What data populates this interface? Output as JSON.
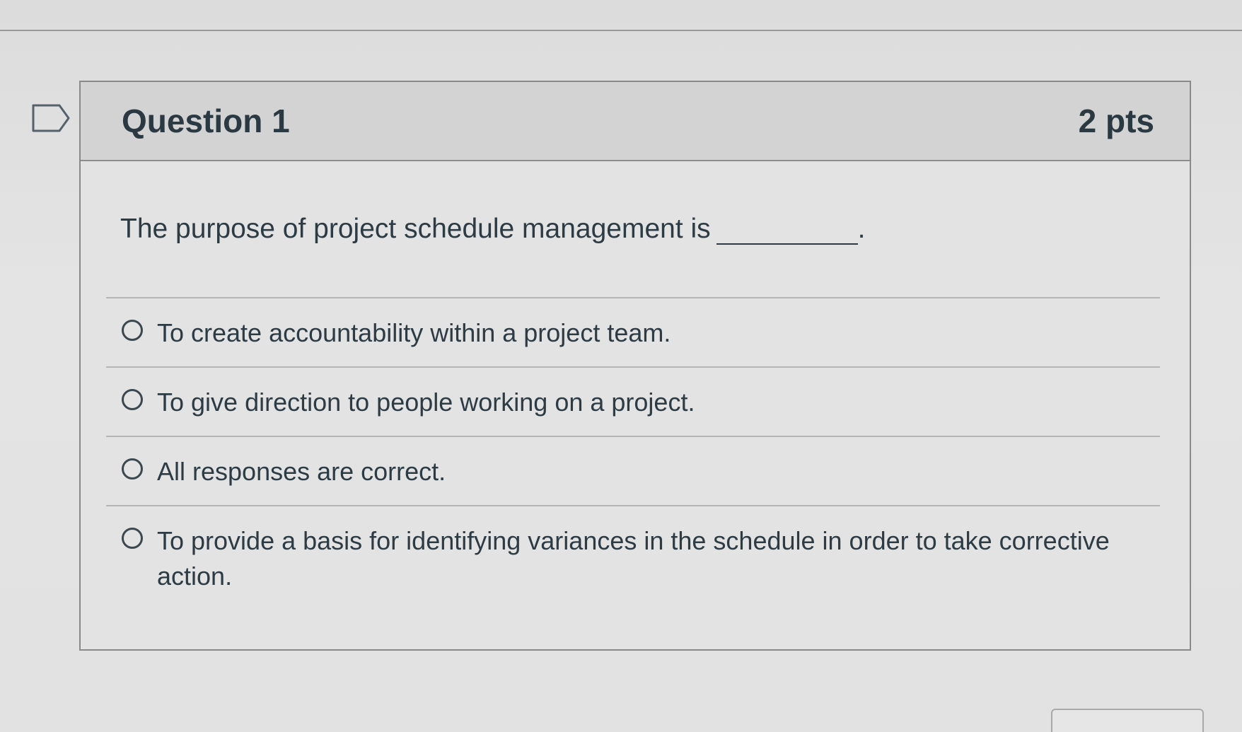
{
  "question": {
    "title": "Question 1",
    "points": "2 pts",
    "text": "The purpose of project schedule management is",
    "text_end": "."
  },
  "answers": [
    {
      "label": "To create accountability within a project team."
    },
    {
      "label": "To give direction to people working on a project."
    },
    {
      "label": "All responses are correct."
    },
    {
      "label": "To provide a basis for identifying variances in the schedule in order to take corrective action."
    }
  ],
  "icons": {
    "flag": "flag-question-icon"
  },
  "colors": {
    "header_bg": "#d3d3d3",
    "text": "#2d3b45",
    "border": "#8a8a8a"
  }
}
